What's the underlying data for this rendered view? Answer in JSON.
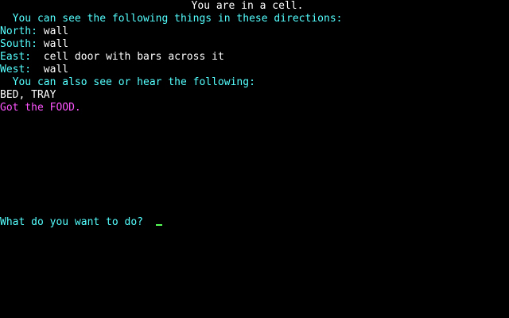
{
  "location_title": "You are in a cell.",
  "directions_header": "  You can see the following things in these directions:",
  "directions": [
    {
      "dir": "North:",
      "gap": " ",
      "what": "wall"
    },
    {
      "dir": "South:",
      "gap": " ",
      "what": "wall"
    },
    {
      "dir": "East:",
      "gap": "  ",
      "what": "cell door with bars across it"
    },
    {
      "dir": "West:",
      "gap": "  ",
      "what": "wall"
    }
  ],
  "also_header": "  You can also see or hear the following:",
  "objects": "BED, TRAY",
  "message": "Got the FOOD.",
  "prompt": "What do you want to do?",
  "colors": {
    "text_white": "#FFFFFF",
    "text_cyan": "#55FFFF",
    "text_magenta": "#FF55FF",
    "cursor_green": "#55FF55",
    "background": "#000000"
  }
}
